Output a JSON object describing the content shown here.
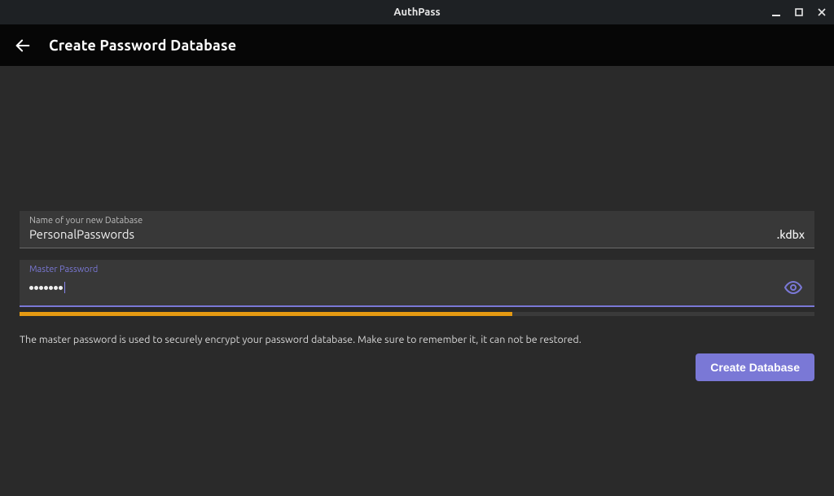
{
  "window": {
    "title": "AuthPass"
  },
  "header": {
    "title": "Create Password Database"
  },
  "form": {
    "db_name": {
      "label": "Name of your new Database",
      "value": "PersonalPasswords",
      "suffix": ".kdbx"
    },
    "master_password": {
      "label": "Master Password",
      "masked_length": 7
    },
    "strength_percent": 62,
    "strength_color": "#e59a12",
    "helper_text": "The master password is used to securely encrypt your password database. Make sure to remember it, it can not be restored.",
    "submit_label": "Create Database"
  },
  "colors": {
    "accent": "#7a78d6"
  }
}
